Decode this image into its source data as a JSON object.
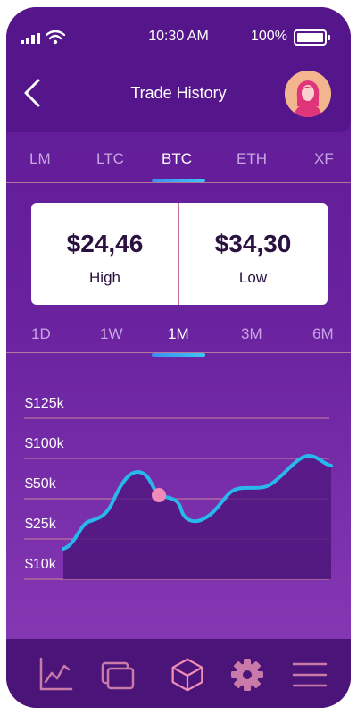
{
  "status_bar": {
    "time": "10:30 AM",
    "battery": "100%"
  },
  "header": {
    "title": "Trade History"
  },
  "coins": [
    {
      "label": "LM",
      "active": false
    },
    {
      "label": "LTC",
      "active": false
    },
    {
      "label": "BTC",
      "active": true
    },
    {
      "label": "ETH",
      "active": false
    },
    {
      "label": "XF",
      "active": false
    }
  ],
  "stats": {
    "high": {
      "value": "$24,46",
      "label": "High"
    },
    "low": {
      "value": "$34,30",
      "label": "Low"
    }
  },
  "ranges": [
    {
      "label": "1D",
      "active": false
    },
    {
      "label": "1W",
      "active": false
    },
    {
      "label": "1M",
      "active": true
    },
    {
      "label": "3M",
      "active": false
    },
    {
      "label": "6M",
      "active": false
    }
  ],
  "chart": {
    "y_labels": [
      "$125k",
      "$100k",
      "$50k",
      "$25k",
      "$10k"
    ],
    "colors": {
      "line": "#29b8ec",
      "marker": "#f08ab8",
      "grid": "#c9849c"
    }
  },
  "nav": [
    {
      "icon": "chart-icon"
    },
    {
      "icon": "cards-icon"
    },
    {
      "icon": "cube-icon"
    },
    {
      "icon": "gear-icon"
    },
    {
      "icon": "menu-icon"
    }
  ]
}
